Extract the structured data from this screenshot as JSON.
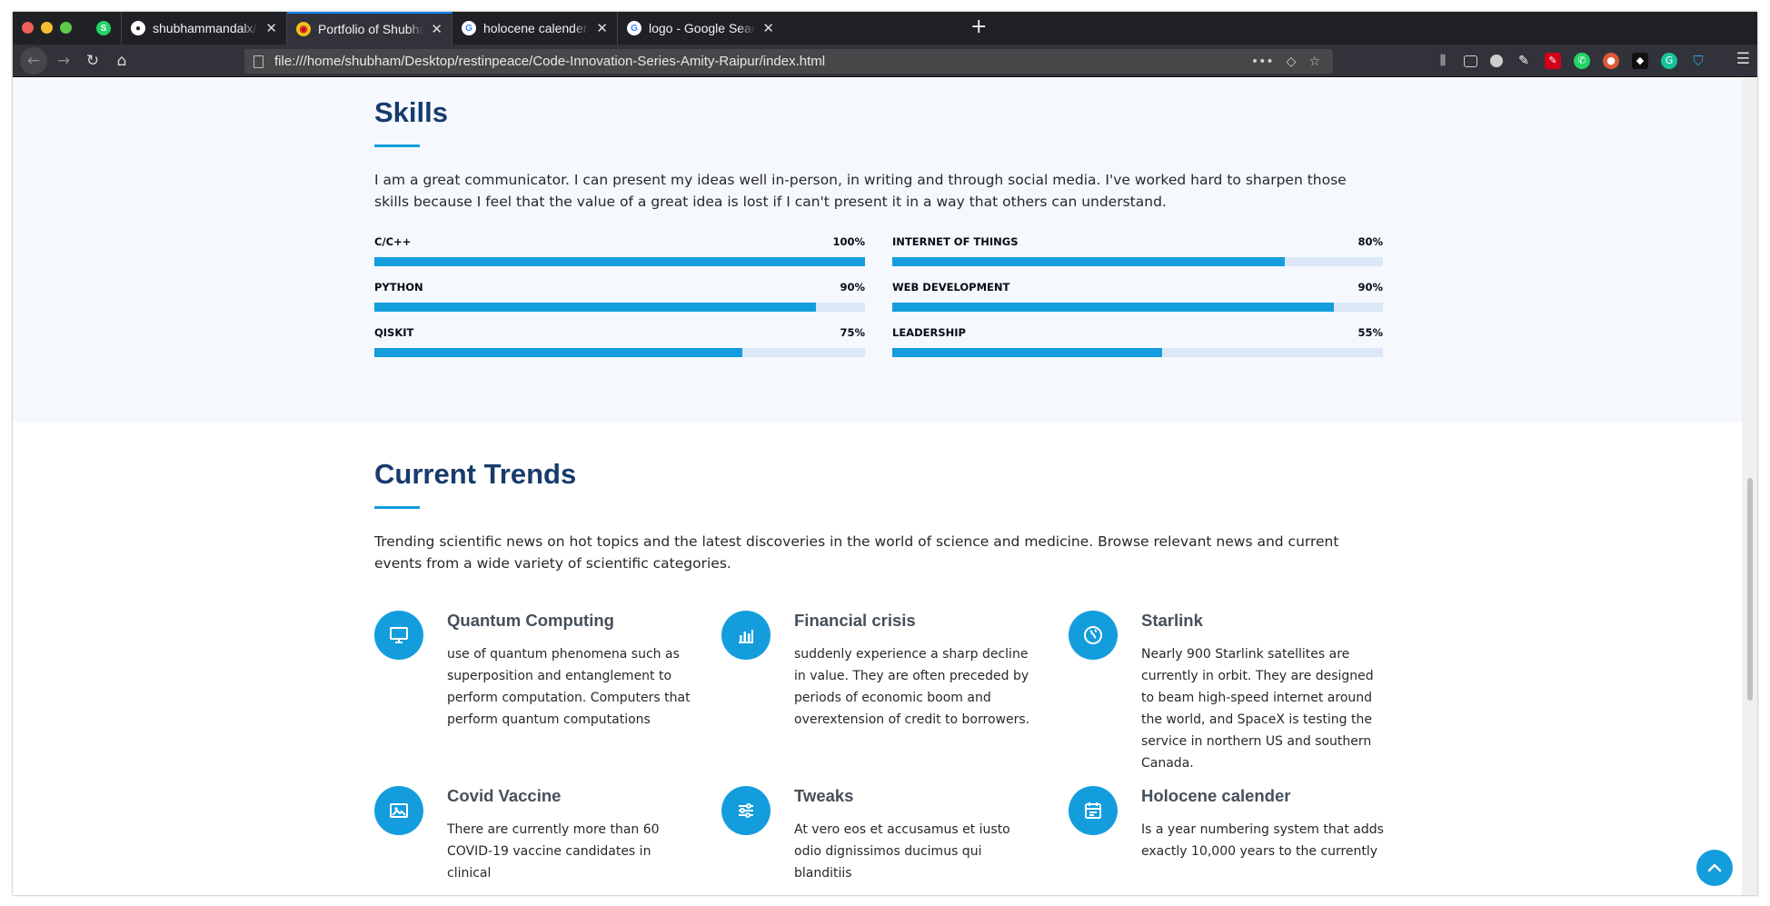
{
  "browser": {
    "tabs": [
      {
        "title": "shubhammandalx/Code-I",
        "favicon": "github-icon"
      },
      {
        "title": "Portfolio of Shubham Ma",
        "favicon": "portfolio-icon"
      },
      {
        "title": "holocene calender - Goo",
        "favicon": "google-icon"
      },
      {
        "title": "logo - Google Search",
        "favicon": "google-icon"
      }
    ],
    "pinned_tab_badge": "S",
    "url": "file:///home/shubham/Desktop/restinpeace/Code-Innovation-Series-Amity-Raipur/index.html",
    "url_actions": "•••",
    "new_tab_symbol": "+",
    "close_symbol": "✕",
    "menu_symbol": "☰"
  },
  "skills": {
    "title": "Skills",
    "description": "I am a great communicator. I can present my ideas well in-person, in writing and through social media. I've worked hard to sharpen those skills because I feel that the value of a great idea is lost if I can't present it in a way that others can understand.",
    "items": [
      {
        "name": "C/C++",
        "value_text": "100%",
        "value": 100
      },
      {
        "name": "INTERNET OF THINGS",
        "value_text": "80%",
        "value": 80
      },
      {
        "name": "PYTHON",
        "value_text": "90%",
        "value": 90
      },
      {
        "name": "WEB DEVELOPMENT",
        "value_text": "90%",
        "value": 90
      },
      {
        "name": "QISKIT",
        "value_text": "75%",
        "value": 75
      },
      {
        "name": "LEADERSHIP",
        "value_text": "55%",
        "value": 55
      }
    ]
  },
  "trends": {
    "title": "Current Trends",
    "description": "Trending scientific news on hot topics and the latest discoveries in the world of science and medicine. Browse relevant news and current events from a wide variety of scientific categories.",
    "items": [
      {
        "title": "Quantum Computing",
        "icon": "monitor-icon",
        "text": "use of quantum phenomena such as superposition and entanglement to perform computation. Computers that perform quantum computations"
      },
      {
        "title": "Financial crisis",
        "icon": "bar-chart-icon",
        "text": "suddenly experience a sharp decline in value. They are often preceded by periods of economic boom and overextension of credit to borrowers."
      },
      {
        "title": "Starlink",
        "icon": "globe-icon",
        "text": "Nearly 900 Starlink satellites are currently in orbit. They are designed to beam high-speed internet around the world, and SpaceX is testing the service in northern US and southern Canada."
      },
      {
        "title": "Covid Vaccine",
        "icon": "image-icon",
        "text": "There are currently more than 60 COVID-19 vaccine candidates in clinical"
      },
      {
        "title": "Tweaks",
        "icon": "sliders-icon",
        "text": "At vero eos et accusamus et iusto odio dignissimos ducimus qui blanditiis"
      },
      {
        "title": "Holocene calender",
        "icon": "calendar-icon",
        "text": "Is a year numbering system that adds exactly 10,000 years to the currently"
      }
    ]
  },
  "colors": {
    "accent": "#149ddd",
    "heading": "#173b6c",
    "track": "#dce8f8"
  }
}
